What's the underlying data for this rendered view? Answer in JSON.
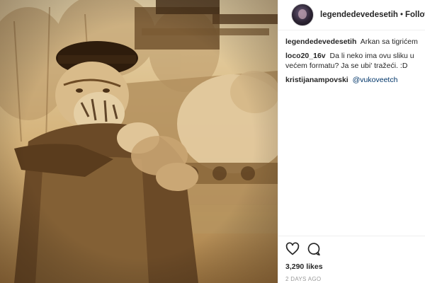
{
  "post": {
    "username": "legendedevedesetih",
    "separator": "•",
    "follow_label": "Following",
    "photo_alt": "Arkan sa tigrićem"
  },
  "comments": [
    {
      "author": "legendedevedesetih",
      "text": "Arkan sa tigrićem",
      "mention": ""
    },
    {
      "author": "loco20_16v",
      "text": "Da li neko ima ovu sliku u većem formatu? Ja se ubi' tražeći. :D",
      "mention": ""
    },
    {
      "author": "kristijanampovski",
      "text": "",
      "mention": "@vukoveetch"
    }
  ],
  "actions": {
    "like_icon": "heart-icon",
    "comment_icon": "comment-bubble-icon",
    "likes": "3,290 likes",
    "timestamp": "2 DAYS AGO"
  },
  "colors": {
    "photo_sepia": "#c9a86f",
    "mention": "#003569",
    "border": "#efefef",
    "muted": "#999999"
  }
}
